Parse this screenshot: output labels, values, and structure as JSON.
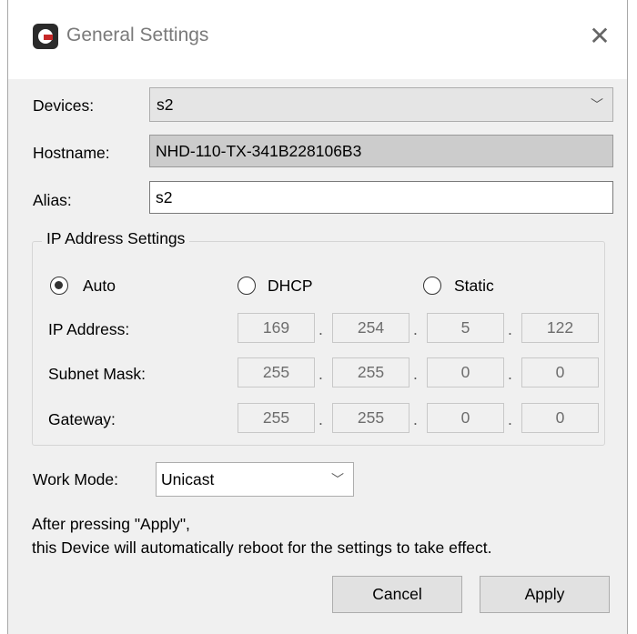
{
  "window": {
    "title": "General Settings",
    "close_glyph": "✕"
  },
  "devices": {
    "label": "Devices:",
    "value": "s2"
  },
  "hostname": {
    "label": "Hostname:",
    "value": "NHD-110-TX-341B228106B3"
  },
  "alias": {
    "label": "Alias:",
    "value": "s2"
  },
  "ip_settings": {
    "group_title": "IP Address Settings",
    "modes": [
      {
        "label": "Auto",
        "checked": true
      },
      {
        "label": "DHCP",
        "checked": false
      },
      {
        "label": "Static",
        "checked": false
      }
    ],
    "ip_address": {
      "label": "IP Address:",
      "octets": [
        "169",
        "254",
        "5",
        "122"
      ]
    },
    "subnet_mask": {
      "label": "Subnet Mask:",
      "octets": [
        "255",
        "255",
        "0",
        "0"
      ]
    },
    "gateway": {
      "label": "Gateway:",
      "octets": [
        "255",
        "255",
        "0",
        "0"
      ]
    },
    "separator": "."
  },
  "work_mode": {
    "label": "Work Mode:",
    "value": "Unicast"
  },
  "notice": {
    "line1": "After pressing \"Apply\",",
    "line2": "this Device will automatically reboot for the settings to take effect."
  },
  "buttons": {
    "cancel": "Cancel",
    "apply": "Apply"
  },
  "icons": {
    "app": "app-logo-icon",
    "close": "close-icon",
    "dropdown": "chevron-down-icon",
    "chevron_glyph": "﹀"
  }
}
